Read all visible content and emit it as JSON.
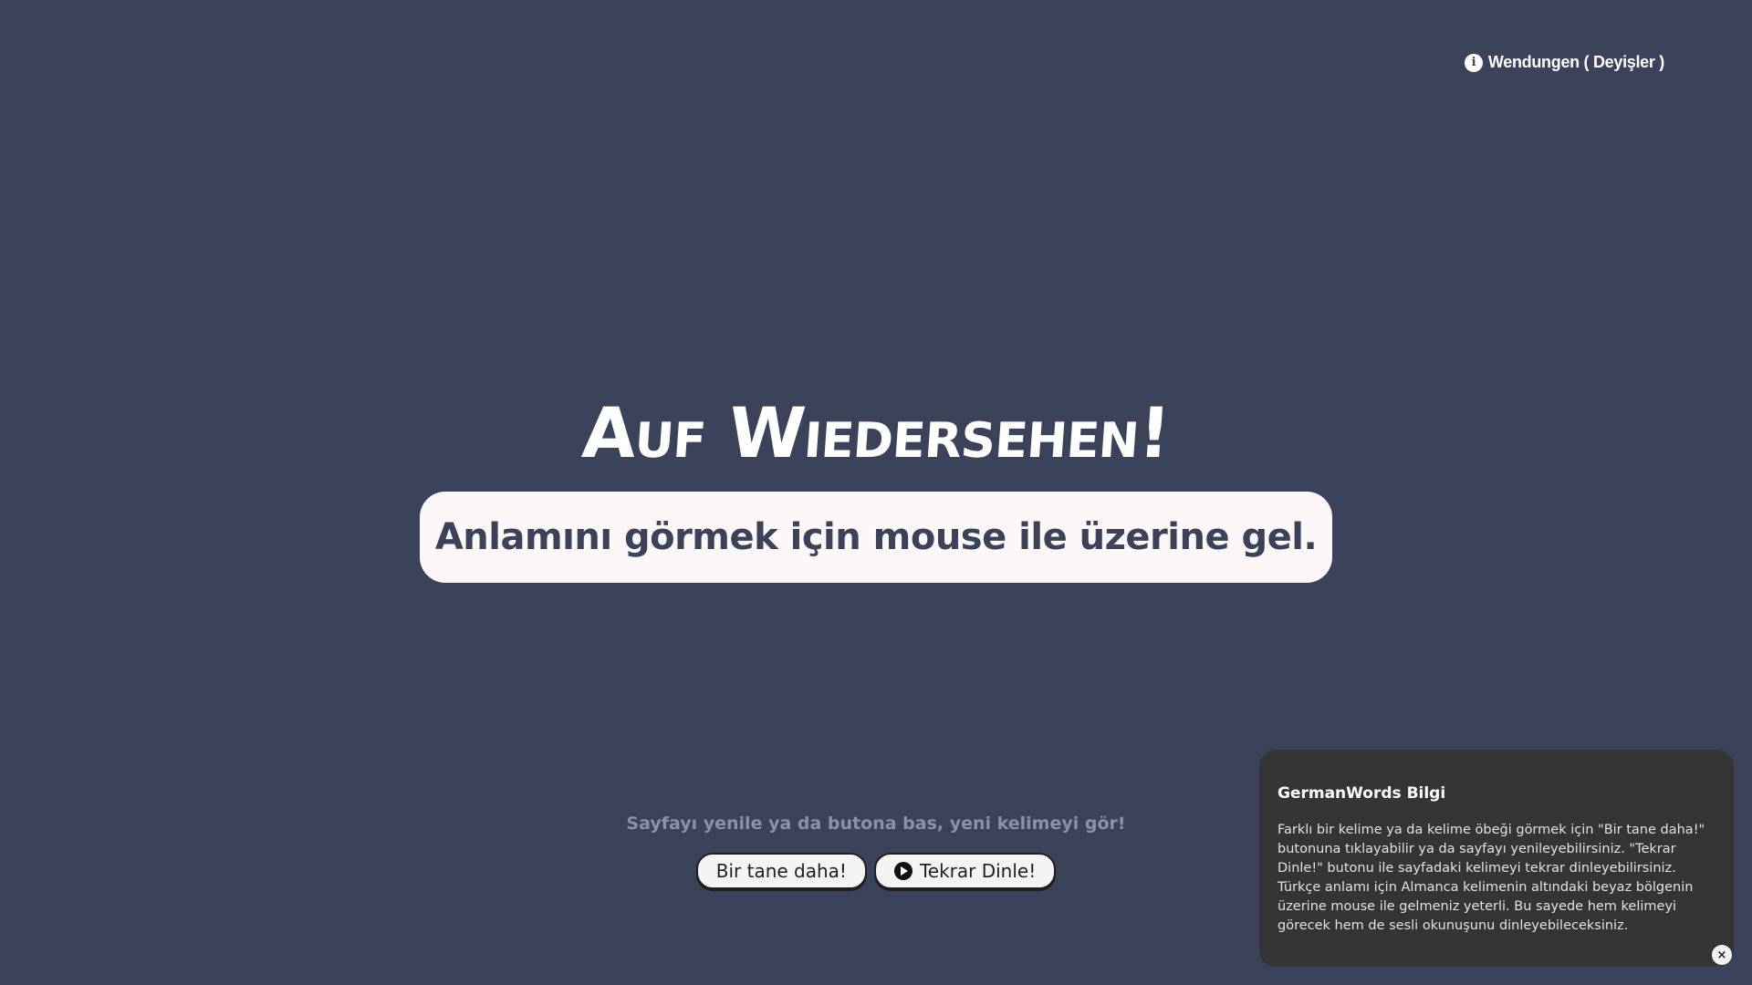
{
  "header": {
    "info_link_label": "Wendungen ( Deyişler )",
    "info_icon": "info-icon"
  },
  "main": {
    "word": "Auf Wiedersehen!",
    "meaning_prompt": "Anlamını görmek için mouse ile üzerine gel.",
    "hint": "Sayfayı yenile ya da butona bas, yeni kelimeyi gör!",
    "buttons": {
      "next_label": "Bir tane daha!",
      "replay_label": "Tekrar Dinle!",
      "replay_icon": "play-icon"
    }
  },
  "info_panel": {
    "title": "GermanWords Bilgi",
    "body": "Farklı bir kelime ya da kelime öbeği görmek için \"Bir tane daha!\" butonuna tıklayabilir ya da sayfayı yenileyebilirsiniz. \"Tekrar Dinle!\" butonu ile sayfadaki kelimeyi tekrar dinleyebilirsiniz. Türkçe anlamı için Almanca kelimenin altındaki beyaz bölgenin üzerine mouse ile gelmeniz yeterli. Bu sayede hem kelimeyi görecek hem de sesli okunuşunu dinleyebileceksiniz.",
    "close_label": "×"
  },
  "colors": {
    "background": "#3a435a",
    "meaning_box": "#fdf8f7",
    "panel": "#353535",
    "hint_text": "#8a92a6"
  }
}
